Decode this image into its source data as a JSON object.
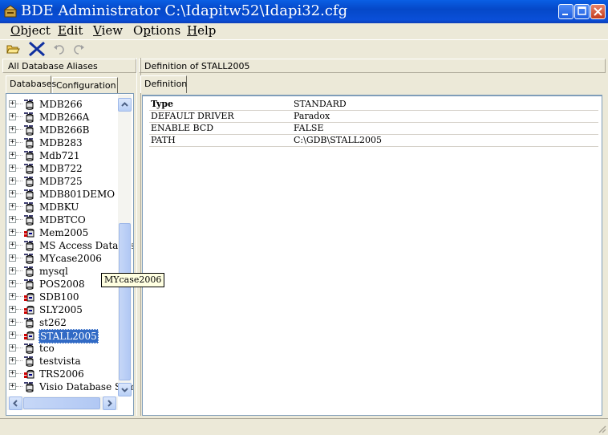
{
  "window": {
    "title": "BDE Administrator  C:\\Idapitw52\\Idapi32.cfg"
  },
  "menu": [
    {
      "label": "Object",
      "key": "O"
    },
    {
      "label": "Edit",
      "key": "E"
    },
    {
      "label": "View",
      "key": "V"
    },
    {
      "label": "Options",
      "key": "p"
    },
    {
      "label": "Help",
      "key": "H"
    }
  ],
  "toolbar": {
    "icons": [
      "open-folder-icon",
      "delete-x-icon",
      "undo-icon",
      "redo-icon"
    ]
  },
  "left_panel": {
    "header": "All Database Aliases",
    "tabs": [
      "Databases",
      "Configuration"
    ],
    "active_tab": "Databases",
    "items": [
      {
        "label": "MDB266",
        "icon": "database-alias"
      },
      {
        "label": "MDB266A",
        "icon": "database-alias"
      },
      {
        "label": "MDB266B",
        "icon": "database-alias"
      },
      {
        "label": "MDB283",
        "icon": "database-alias"
      },
      {
        "label": "Mdb721",
        "icon": "database-alias"
      },
      {
        "label": "MDB722",
        "icon": "database-alias"
      },
      {
        "label": "MDB725",
        "icon": "database-alias"
      },
      {
        "label": "MDB801DEMO",
        "icon": "database-alias"
      },
      {
        "label": "MDBKU",
        "icon": "database-alias"
      },
      {
        "label": "MDBTCO",
        "icon": "database-alias"
      },
      {
        "label": "Mem2005",
        "icon": "native-alias"
      },
      {
        "label": "MS Access Database",
        "icon": "database-alias"
      },
      {
        "label": "MYcase2006",
        "icon": "database-alias"
      },
      {
        "label": "mysql",
        "icon": "database-alias"
      },
      {
        "label": "POS2008",
        "icon": "database-alias"
      },
      {
        "label": "SDB100",
        "icon": "native-alias"
      },
      {
        "label": "SLY2005",
        "icon": "native-alias"
      },
      {
        "label": "st262",
        "icon": "database-alias"
      },
      {
        "label": "STALL2005",
        "icon": "native-alias",
        "selected": true
      },
      {
        "label": "tco",
        "icon": "database-alias"
      },
      {
        "label": "testvista",
        "icon": "database-alias"
      },
      {
        "label": "TRS2006",
        "icon": "native-alias"
      },
      {
        "label": "Visio Database Samp",
        "icon": "database-alias"
      }
    ],
    "tooltip": "MYcase2006"
  },
  "right_panel": {
    "header": "Definition of STALL2005",
    "tabs": [
      "Definition"
    ],
    "properties": [
      {
        "key": "Type",
        "value": "STANDARD",
        "bold": true
      },
      {
        "key": "DEFAULT DRIVER",
        "value": "Paradox"
      },
      {
        "key": "ENABLE BCD",
        "value": "FALSE"
      },
      {
        "key": "PATH",
        "value": "C:\\GDB\\STALL2005"
      }
    ]
  },
  "colors": {
    "titlebar": "#0a4fd8",
    "selection": "#316ac5",
    "face": "#ece9d8"
  }
}
